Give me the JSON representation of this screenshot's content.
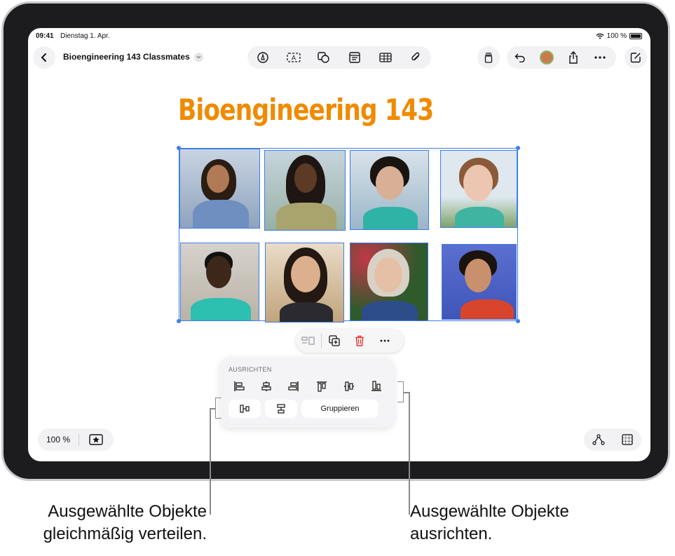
{
  "status_bar": {
    "time": "09:41",
    "date": "Dienstag 1. Apr.",
    "battery": "100 %"
  },
  "toolbar": {
    "document_title": "Bioengineering 143 Classmates",
    "center_tools": [
      "pen-icon",
      "text-box-icon",
      "shapes-icon",
      "sticky-note-icon",
      "table-icon",
      "attachment-icon"
    ],
    "right_tools": [
      "view-options-icon",
      "undo-icon",
      "collaborator-avatar",
      "share-icon",
      "more-icon",
      "compose-icon"
    ]
  },
  "board": {
    "title": "Bioengineering 143"
  },
  "photos": [
    {
      "label": "classmate-1"
    },
    {
      "label": "classmate-2"
    },
    {
      "label": "classmate-3"
    },
    {
      "label": "classmate-4"
    },
    {
      "label": "classmate-5"
    },
    {
      "label": "classmate-6"
    },
    {
      "label": "classmate-7"
    },
    {
      "label": "classmate-8"
    }
  ],
  "selection_menu": {
    "items": [
      "arrange-icon",
      "duplicate-icon",
      "delete-icon",
      "more-icon"
    ]
  },
  "align_popover": {
    "header": "AUSRICHTEN",
    "align_buttons": [
      "align-left",
      "align-center-horizontal",
      "align-right",
      "align-top",
      "align-center-vertical",
      "align-bottom"
    ],
    "distribute_buttons": [
      "distribute-horizontal",
      "distribute-vertical"
    ],
    "group_label": "Gruppieren"
  },
  "bottom_left": {
    "zoom": "100 %"
  },
  "callouts": {
    "left_line1": "Ausgewählte Objekte",
    "left_line2": "gleichmäßig verteilen.",
    "right_line1": "Ausgewählte Objekte",
    "right_line2": "ausrichten."
  },
  "colors": {
    "accent": "#3d7eea",
    "title": "#f08a00",
    "delete": "#e5362b"
  }
}
